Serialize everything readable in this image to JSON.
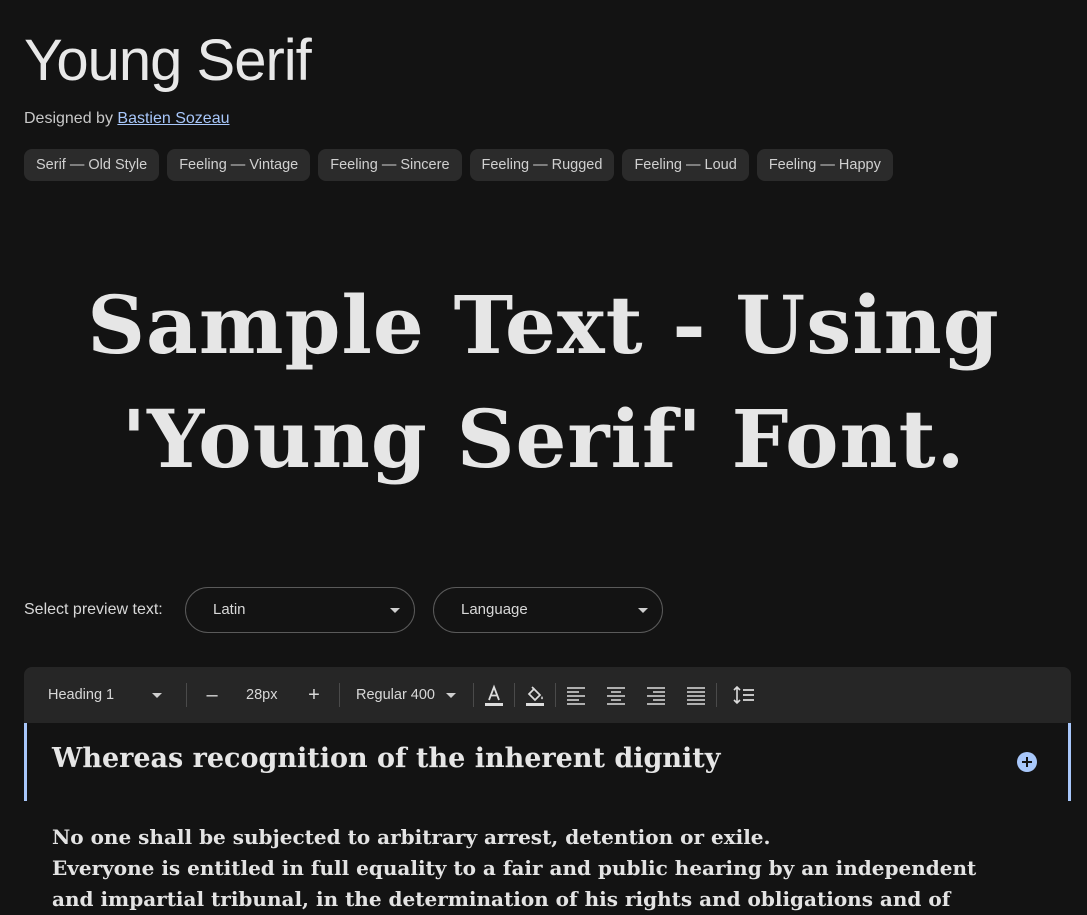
{
  "header": {
    "title": "Young Serif",
    "designed_by_prefix": "Designed by",
    "designer_name": "Bastien Sozeau"
  },
  "tags": [
    "Serif — Old Style",
    "Feeling — Vintage",
    "Feeling — Sincere",
    "Feeling — Rugged",
    "Feeling — Loud",
    "Feeling — Happy"
  ],
  "sample": {
    "line1": "Sample Text - Using",
    "line2": "'Young Serif' Font."
  },
  "preview": {
    "label": "Select preview text:",
    "script_value": "Latin",
    "language_value": "Language"
  },
  "toolbar": {
    "style_value": "Heading 1",
    "minus": "–",
    "size_value": "28px",
    "plus": "+",
    "weight_value": "Regular 400"
  },
  "editor": {
    "heading": "Whereas recognition of the inherent dignity",
    "body_line1": "No one shall be subjected to arbitrary arrest, detention or exile.",
    "body_line2": "Everyone is entitled in full equality to a fair and public hearing by an independent",
    "body_line3": "and impartial tribunal, in the determination of his rights and obligations and of"
  },
  "colors": {
    "background": "#131313",
    "accent": "#a8c7fa",
    "tag_bg": "#2b2b2b",
    "toolbar_bg": "#262626"
  }
}
